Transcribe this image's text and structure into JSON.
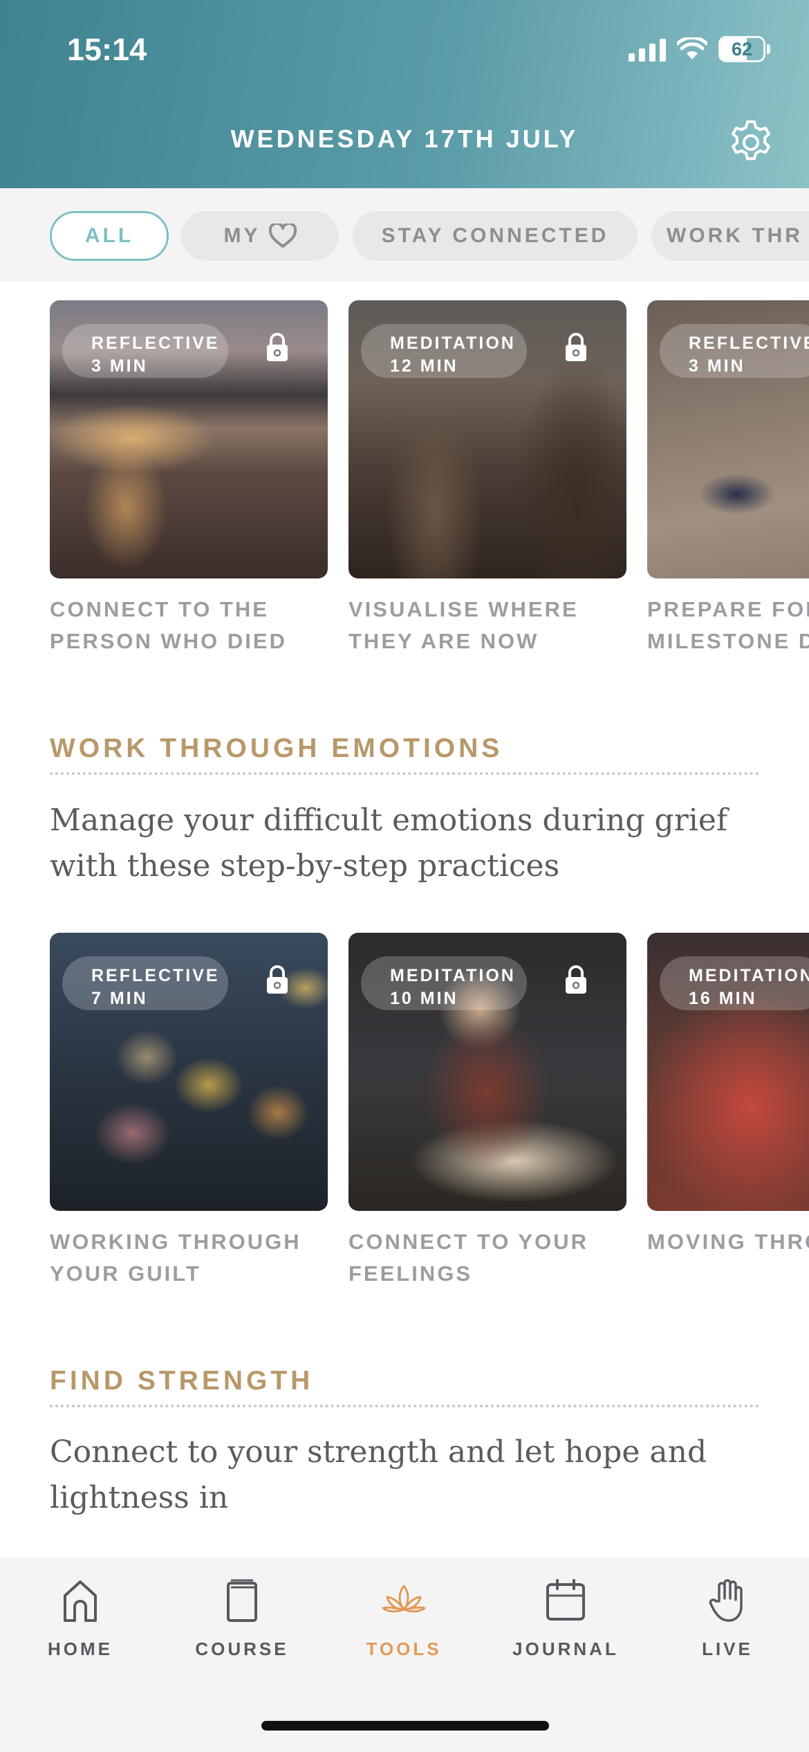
{
  "status_bar": {
    "time": "15:14",
    "battery": "62",
    "battery_level": 0.62
  },
  "header": {
    "date": "WEDNESDAY 17TH JULY",
    "settings_icon": "gear-icon"
  },
  "filters": [
    {
      "label": "ALL",
      "active": true
    },
    {
      "label": "MY",
      "icon": "heart-icon",
      "active": false
    },
    {
      "label": "STAY CONNECTED",
      "active": false
    },
    {
      "label": "WORK THR",
      "active": false
    }
  ],
  "row1": [
    {
      "type": "REFLECTIVE",
      "duration": "3 MIN",
      "locked": true,
      "title": "CONNECT TO THE PERSON WHO DIED"
    },
    {
      "type": "MEDITATION",
      "duration": "12 MIN",
      "locked": true,
      "title": "VISUALISE WHERE THEY ARE NOW"
    },
    {
      "type": "REFLECTIVE",
      "duration": "3 MIN",
      "locked": false,
      "title": "PREPARE FOR MILESTONE D"
    }
  ],
  "section1": {
    "title": "WORK THROUGH EMOTIONS",
    "description": "Manage your difficult emotions during grief with these step-by-step practices"
  },
  "row2": [
    {
      "type": "REFLECTIVE",
      "duration": "7 MIN",
      "locked": true,
      "title": "WORKING THROUGH YOUR GUILT"
    },
    {
      "type": "MEDITATION",
      "duration": "10 MIN",
      "locked": true,
      "title": "CONNECT TO YOUR FEELINGS"
    },
    {
      "type": "MEDITATION",
      "duration": "16 MIN",
      "locked": false,
      "title": "MOVING THRO PAIN"
    }
  ],
  "section2": {
    "title": "FIND STRENGTH",
    "description": "Connect to your strength and let hope and lightness in"
  },
  "nav": [
    {
      "label": "HOME",
      "icon": "home-icon",
      "active": false
    },
    {
      "label": "COURSE",
      "icon": "book-icon",
      "active": false
    },
    {
      "label": "TOOLS",
      "icon": "lotus-icon",
      "active": true
    },
    {
      "label": "JOURNAL",
      "icon": "calendar-icon",
      "active": false
    },
    {
      "label": "LIVE",
      "icon": "hand-icon",
      "active": false
    }
  ],
  "colors": {
    "accent_teal": "#7fbfc6",
    "section_gold": "#b8986a",
    "nav_active": "#e29a57"
  }
}
